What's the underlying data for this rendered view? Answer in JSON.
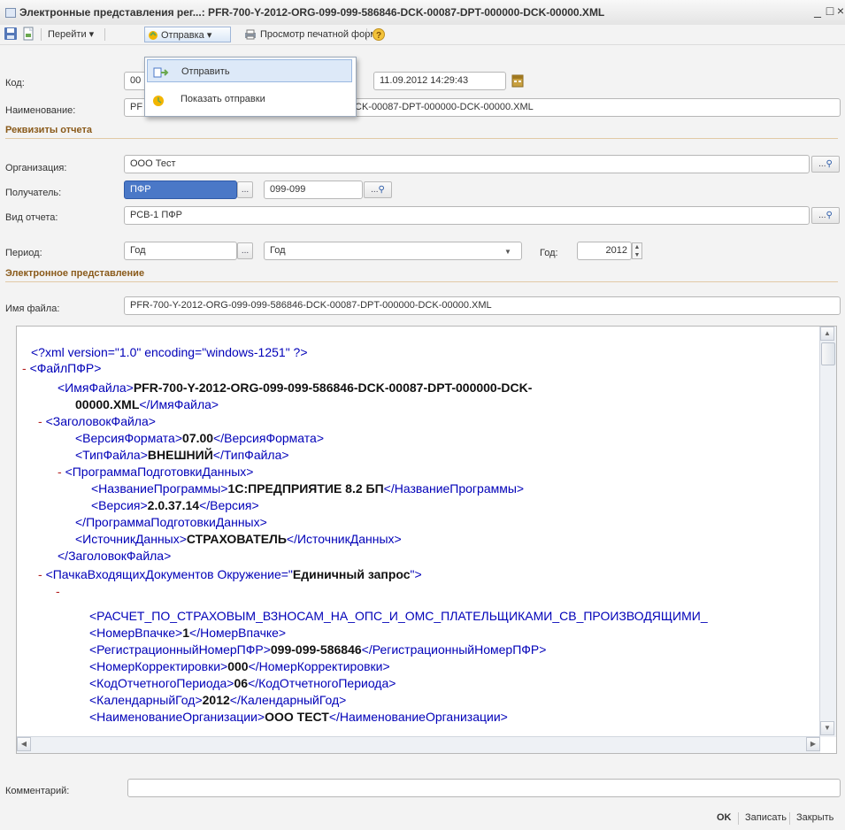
{
  "window": {
    "title": "Электронные представления рег...: PFR-700-Y-2012-ORG-099-099-586846-DCK-00087-DPT-000000-DCK-00000.XML",
    "minimize": "_",
    "maximize": "□",
    "close": "×"
  },
  "toolbar": {
    "goto": "Перейти ▾",
    "send": "Отправка ▾",
    "print_preview": "Просмотр печатной формы",
    "help": "?"
  },
  "send_menu": {
    "items": [
      "Отправить",
      "Показать отправки"
    ]
  },
  "form": {
    "code_label": "Код:",
    "code_value": "00",
    "date_value": "11.09.2012 14:29:43",
    "name_label": "Наименование:",
    "name_value_left": "PF",
    "name_value_right": "CK-00087-DPT-000000-DCK-00000.XML",
    "section_report": "Реквизиты отчета",
    "org_label": "Организация:",
    "org_value": "ООО Тест",
    "recipient_label": "Получатель:",
    "recipient_value": "ПФР",
    "recipient_code": "099-099",
    "report_type_label": "Вид отчета:",
    "report_type_value": "РСВ-1 ПФР",
    "period_label": "Период:",
    "period_value1": "Год",
    "period_value2": "Год",
    "year_label": "Год:",
    "year_value": "2012",
    "section_electronic": "Электронное представление",
    "filename_label": "Имя файла:",
    "filename_value": "PFR-700-Y-2012-ORG-099-099-586846-DCK-00087-DPT-000000-DCK-00000.XML",
    "comment_label": "Комментарий:",
    "comment_value": ""
  },
  "xml": {
    "l1": "<?xml version=\"1.0\" encoding=\"windows-1251\" ?>",
    "minus": "-",
    "l2": "<ФайлПФР>",
    "l3a": "<ИмяФайла>",
    "l3b": "PFR-700-Y-2012-ORG-099-099-586846-DCK-00087-DPT-000000-DCK-",
    "l4b": "00000.XML",
    "l4c": "</ИмяФайла>",
    "l5": "<ЗаголовокФайла>",
    "l6a": "<ВерсияФормата>",
    "l6b": "07.00",
    "l6c": "</ВерсияФормата>",
    "l7a": "<ТипФайла>",
    "l7b": "ВНЕШНИЙ",
    "l7c": "</ТипФайла>",
    "l8": "<ПрограммаПодготовкиДанных>",
    "l9a": "<НазваниеПрограммы>",
    "l9b": "1С:ПРЕДПРИЯТИЕ 8.2 БП",
    "l9c": "</НазваниеПрограммы>",
    "l10a": "<Версия>",
    "l10b": "2.0.37.14",
    "l10c": "</Версия>",
    "l11": "</ПрограммаПодготовкиДанных>",
    "l12a": "<ИсточникДанных>",
    "l12b": "СТРАХОВАТЕЛЬ",
    "l12c": "</ИсточникДанных>",
    "l13": "</ЗаголовокФайла>",
    "l14a": "<ПачкаВходящихДокументов Окружение=\"",
    "l14b": "Единичный запрос",
    "l14c": "\">",
    "l16": "<РАСЧЕТ_ПО_СТРАХОВЫМ_ВЗНОСАМ_НА_ОПС_И_ОМС_ПЛАТЕЛЬЩИКАМИ_СВ_ПРОИЗВОДЯЩИМИ_",
    "l17a": "<НомерВпачке>",
    "l17b": "1",
    "l17c": "</НомерВпачке>",
    "l18a": "<РегистрационныйНомерПФР>",
    "l18b": "099-099-586846",
    "l18c": "</РегистрационныйНомерПФР>",
    "l19a": "<НомерКорректировки>",
    "l19b": "000",
    "l19c": "</НомерКорректировки>",
    "l20a": "<КодОтчетногоПериода>",
    "l20b": "06",
    "l20c": "</КодОтчетногоПериода>",
    "l21a": "<КалендарныйГод>",
    "l21b": "2012",
    "l21c": "</КалендарныйГод>",
    "l22a": "<НаименованиеОрганизации>",
    "l22b": "ООО ТЕСТ",
    "l22c": "</НаименованиеОрганизации>"
  },
  "buttons": {
    "ellipsis": "...",
    "ok": "OK",
    "save": "Записать",
    "close": "Закрыть"
  },
  "colors": {
    "xml_tag": "#0000b8",
    "xml_value": "#111111",
    "section_header": "#8a5a1a",
    "selection": "#4a78c7"
  }
}
